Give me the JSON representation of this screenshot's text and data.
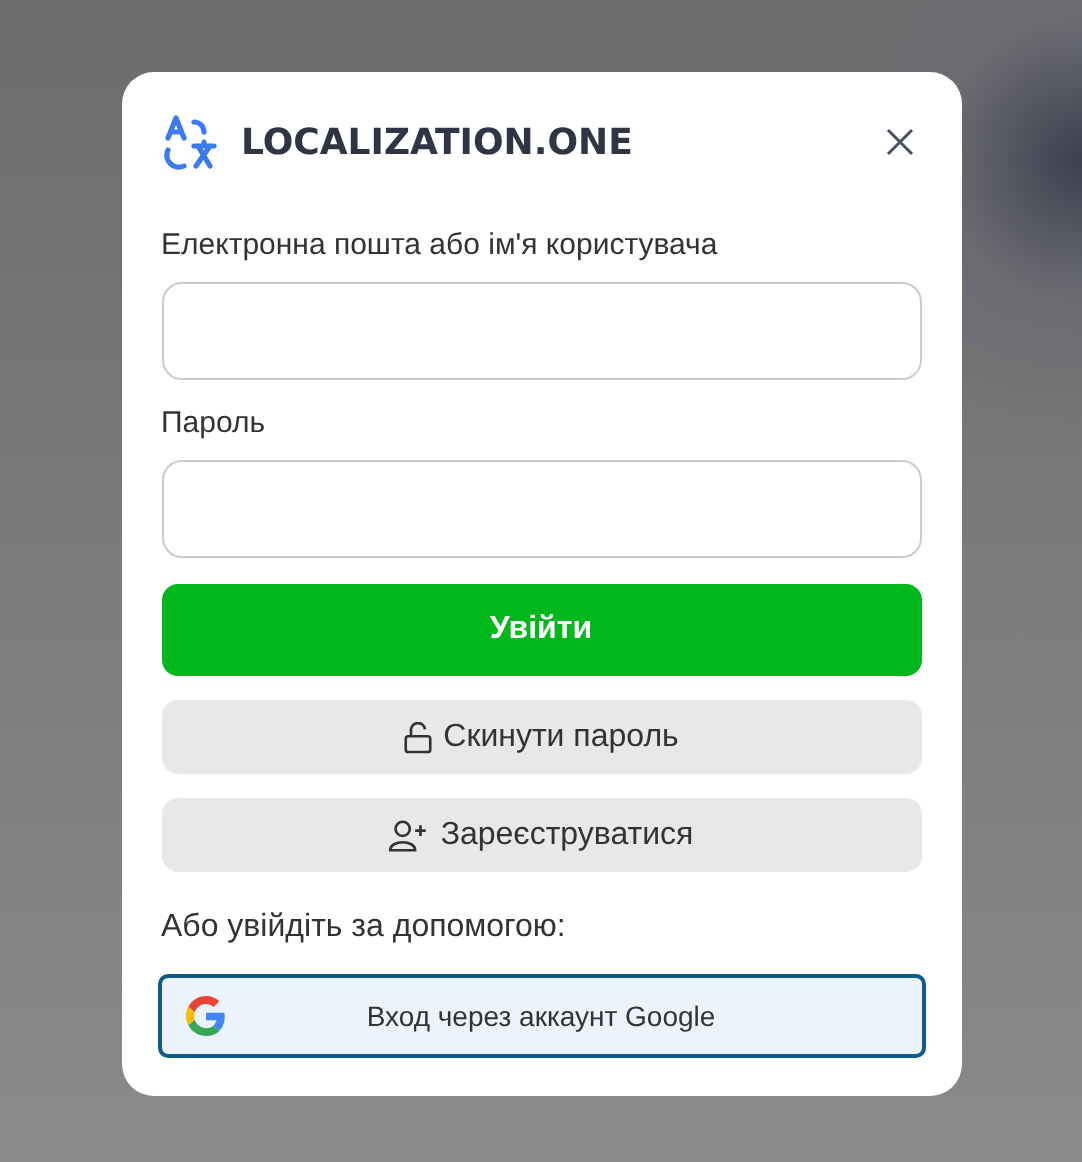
{
  "dialog": {
    "title": "LOCALIZATION.ONE"
  },
  "fields": [
    {
      "label": "Електронна пошта або ім'я користувача"
    },
    {
      "label": "Пароль"
    }
  ],
  "buttons": [
    {
      "label": "Увійти",
      "kind": "primary"
    },
    {
      "label": "Скинути пароль",
      "kind": "reset"
    },
    {
      "label": "Зареєструватися",
      "kind": "register"
    }
  ],
  "alt_login": {
    "prompt": "Або увійдіть за допомогою:",
    "google_button": "Вход через аккаунт Google"
  }
}
